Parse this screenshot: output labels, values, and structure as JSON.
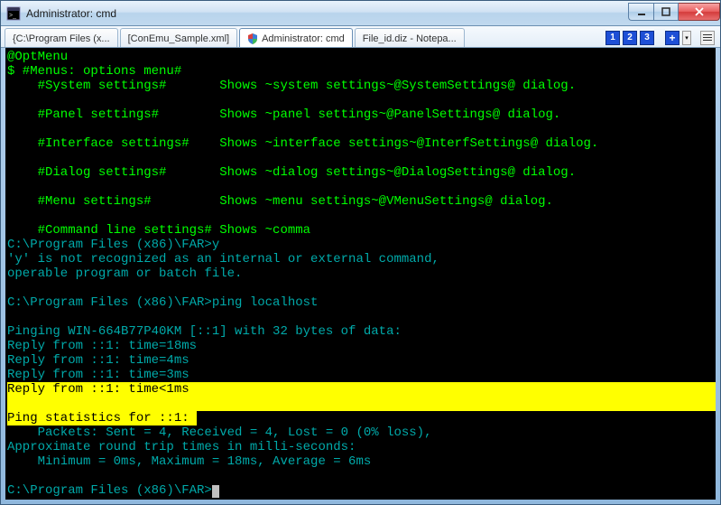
{
  "window": {
    "title": "Administrator: cmd"
  },
  "tabs": [
    {
      "label": "{C:\\Program Files (x...",
      "active": false,
      "shield": false
    },
    {
      "label": "[ConEmu_Sample.xml]",
      "active": false,
      "shield": false
    },
    {
      "label": "Administrator: cmd",
      "active": true,
      "shield": true
    },
    {
      "label": "File_id.diz - Notepa...",
      "active": false,
      "shield": false
    }
  ],
  "tabbar": {
    "nums": [
      "1",
      "2",
      "3"
    ],
    "plus": "+",
    "drop": "▾"
  },
  "term": {
    "l0": "@OptMenu",
    "l1": "$ #Menus: options menu#",
    "l2": "    #System settings#       Shows ~system settings~@SystemSettings@ dialog.",
    "l3": "    #Panel settings#        Shows ~panel settings~@PanelSettings@ dialog.",
    "l4": "    #Interface settings#    Shows ~interface settings~@InterfSettings@ dialog.",
    "l5": "    #Dialog settings#       Shows ~dialog settings~@DialogSettings@ dialog.",
    "l6": "    #Menu settings#         Shows ~menu settings~@VMenuSettings@ dialog.",
    "l7": "    #Command line settings# Shows ~comma",
    "l8": "C:\\Program Files (x86)\\FAR>y",
    "l9": "'y' is not recognized as an internal or external command,",
    "l10": "operable program or batch file.",
    "l11": "C:\\Program Files (x86)\\FAR>ping localhost",
    "l12": "Pinging WIN-664B77P40KM [::1] with 32 bytes of data:",
    "l13": "Reply from ::1: time=18ms",
    "l14": "Reply from ::1: time=4ms",
    "l15": "Reply from ::1: time=3ms",
    "l16a": "Reply from ",
    "l16b": "::1: time<1ms",
    "l17": "Ping statistics for ::1:",
    "l18": "    Packets: Sent = 4, Received = 4, Lost = 0 (0% loss),",
    "l19": "Approximate round trip times in milli-seconds:",
    "l20": "    Minimum = 0ms, Maximum = 18ms, Average = 6ms",
    "l21": "C:\\Program Files (x86)\\FAR>"
  }
}
